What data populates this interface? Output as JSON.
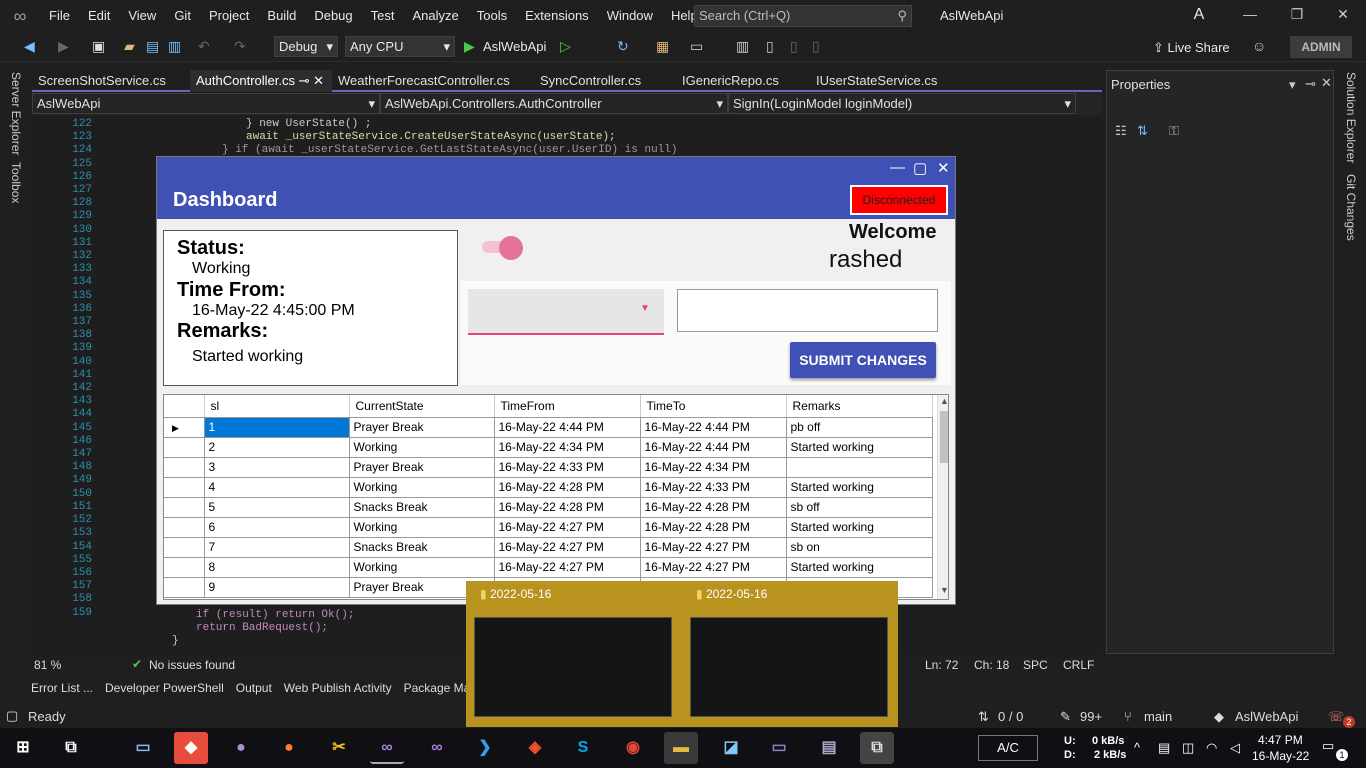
{
  "app": {
    "solution_name": "AslWebApi",
    "avatar_letter": "A",
    "user_badge": "ADMIN",
    "live_share": "Live Share"
  },
  "menu": [
    "File",
    "Edit",
    "View",
    "Git",
    "Project",
    "Build",
    "Debug",
    "Test",
    "Analyze",
    "Tools",
    "Extensions",
    "Window",
    "Help"
  ],
  "search": {
    "placeholder": "Search (Ctrl+Q)"
  },
  "toolbar": {
    "config": "Debug",
    "platform": "Any CPU",
    "run_target": "AslWebApi"
  },
  "side": {
    "left": [
      "Server Explorer",
      "Toolbox"
    ],
    "right": [
      "Solution Explorer",
      "Git Changes"
    ]
  },
  "tabs": [
    "ScreenShotService.cs",
    "AuthController.cs",
    "WeatherForecastController.cs",
    "SyncController.cs",
    "IGenericRepo.cs",
    "IUserStateService.cs"
  ],
  "navbar": {
    "project": "AslWebApi",
    "class": "AslWebApi.Controllers.AuthController",
    "member": "SignIn(LoginModel loginModel)"
  },
  "editor": {
    "line_numbers": [
      "122",
      "123",
      "124",
      "125",
      "126",
      "127",
      "128",
      "129",
      "130",
      "131",
      "132",
      "133",
      "134",
      "135",
      "136",
      "137",
      "138",
      "139",
      "140",
      "141",
      "142",
      "143",
      "144",
      "145",
      "146",
      "147",
      "148",
      "149",
      "150",
      "151",
      "152",
      "153",
      "154",
      "155",
      "156",
      "157",
      "158",
      "159"
    ],
    "code_top": [
      "} new UserState() ;",
      "await _userStateService.CreateUserStateAsync(userState);",
      "} if (await _userStateService.GetLastStateAsync(user.UserID) is null)"
    ],
    "code_bottom": [
      "if (result) return Ok();",
      "return BadRequest();",
      "}"
    ]
  },
  "editor_status": {
    "zoom": "81 %",
    "issues": "No issues found",
    "ln": "Ln: 72",
    "ch": "Ch: 18",
    "spc": "SPC",
    "crlf": "CRLF"
  },
  "properties": {
    "title": "Properties"
  },
  "bottom_tabs": [
    "Error List ...",
    "Developer PowerShell",
    "Output",
    "Web Publish Activity",
    "Package Mar"
  ],
  "statusbar": {
    "ready": "Ready",
    "errors": "0 / 0",
    "pencil": "99+",
    "branch": "main",
    "repo": "AslWebApi",
    "notif": "2"
  },
  "taskbar": {
    "ac": "A/C",
    "net_u_label": "U:",
    "net_d_label": "D:",
    "net_u": "0 kB/s",
    "net_d": "2 kB/s",
    "time": "4:47 PM",
    "date": "16-May-22",
    "notif_count": "1"
  },
  "dashboard": {
    "title": "Dashboard",
    "connection": "Disconnected",
    "status_label": "Status:",
    "status_value": "Working",
    "time_label": "Time From:",
    "time_value": "16-May-22 4:45:00 PM",
    "remarks_label": "Remarks:",
    "remarks_value": "Started working",
    "welcome": "Welcome",
    "username": "rashed",
    "submit": "SUBMIT CHANGES",
    "columns": [
      "sl",
      "CurrentState",
      "TimeFrom",
      "TimeTo",
      "Remarks"
    ],
    "rows": [
      [
        "1",
        "Prayer Break",
        "16-May-22 4:44 PM",
        "16-May-22 4:44 PM",
        "pb off"
      ],
      [
        "2",
        "Working",
        "16-May-22 4:34 PM",
        "16-May-22 4:44 PM",
        "Started working"
      ],
      [
        "3",
        "Prayer Break",
        "16-May-22 4:33 PM",
        "16-May-22 4:34 PM",
        ""
      ],
      [
        "4",
        "Working",
        "16-May-22 4:28 PM",
        "16-May-22 4:33 PM",
        "Started working"
      ],
      [
        "5",
        "Snacks Break",
        "16-May-22 4:28 PM",
        "16-May-22 4:28 PM",
        "sb off"
      ],
      [
        "6",
        "Working",
        "16-May-22 4:27 PM",
        "16-May-22 4:28 PM",
        "Started working"
      ],
      [
        "7",
        "Snacks Break",
        "16-May-22 4:27 PM",
        "16-May-22 4:27 PM",
        "sb on"
      ],
      [
        "8",
        "Working",
        "16-May-22 4:27 PM",
        "16-May-22 4:27 PM",
        "Started working"
      ],
      [
        "9",
        "Prayer Break",
        "",
        "",
        ""
      ]
    ]
  },
  "previews": [
    {
      "title": "2022-05-16"
    },
    {
      "title": "2022-05-16"
    }
  ]
}
